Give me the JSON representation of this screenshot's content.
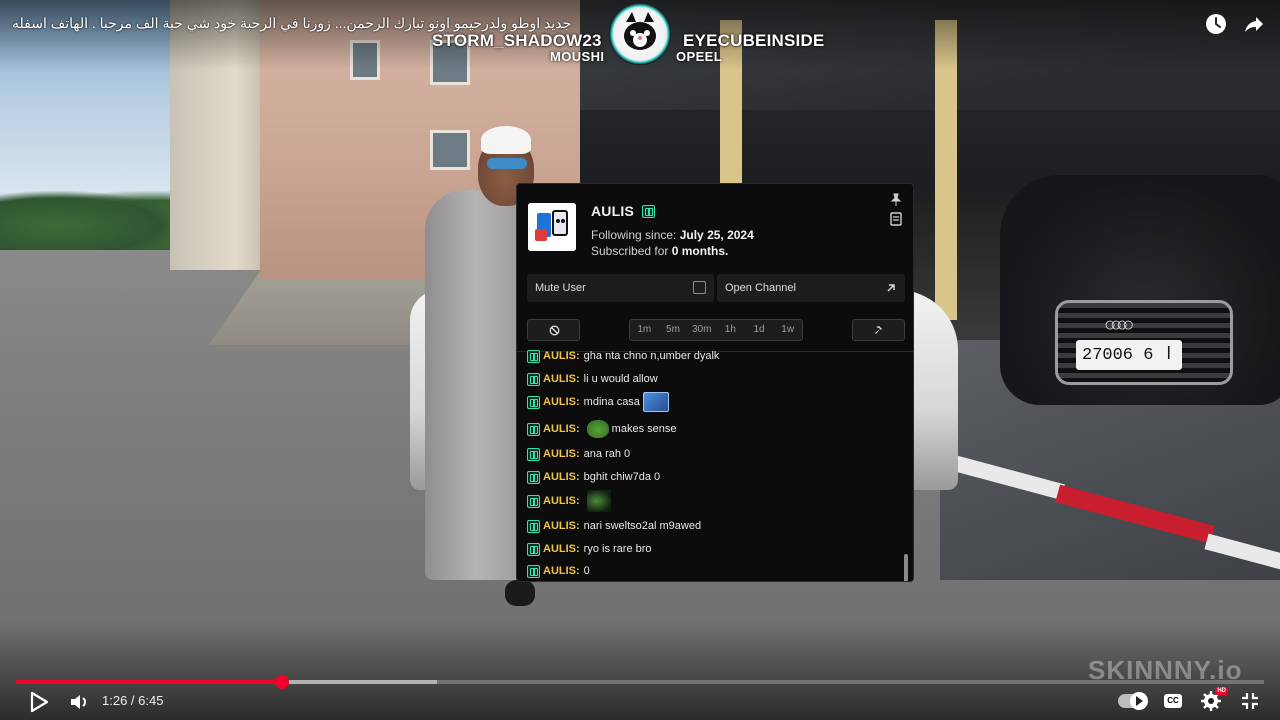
{
  "video": {
    "title": "جديد اوطو ولدرحيمو اونو تبارك الرحمن... زورنا في الرحبة خود شي حبة الف مرحبا . الهاتف اسفله",
    "plate_text": "27006 ا 6",
    "watermark": "SKINNNY.io"
  },
  "collab": {
    "left_name": "STORM_SHADOW23",
    "left_sub": "MOUSHI",
    "right_name": "EYECUBEINSIDE",
    "right_sub": "OPEEL"
  },
  "user_card": {
    "username": "AULIS",
    "following_label": "Following since:",
    "following_date": "July 25, 2024",
    "subscribed_label": "Subscribed for",
    "subscribed_value": "0 months.",
    "mute_label": "Mute User",
    "open_channel_label": "Open Channel",
    "timeouts": [
      "1m",
      "5m",
      "30m",
      "1h",
      "1d",
      "1w"
    ],
    "colors": {
      "badge": "#34e3a8",
      "username": "#f0c248"
    }
  },
  "chat": {
    "messages": [
      {
        "user": "AULIS:",
        "text": "gha nta chno n,umber dyalk",
        "emote": ""
      },
      {
        "user": "AULIS:",
        "text": "li u would allow",
        "emote": ""
      },
      {
        "user": "AULIS:",
        "text": "mdina casa",
        "emote": "card-emote"
      },
      {
        "user": "AULIS:",
        "text": "makes sense",
        "emote": "pepe-emote"
      },
      {
        "user": "AULIS:",
        "text": "ana rah 0",
        "emote": ""
      },
      {
        "user": "AULIS:",
        "text": "bghit chiw7da 0",
        "emote": ""
      },
      {
        "user": "AULIS:",
        "text": "",
        "emote": "pepe-dark-emote"
      },
      {
        "user": "AULIS:",
        "text": "nari sweltso2al m9awed",
        "emote": ""
      },
      {
        "user": "AULIS:",
        "text": "ryo is rare bro",
        "emote": ""
      },
      {
        "user": "AULIS:",
        "text": "0",
        "emote": ""
      }
    ]
  },
  "player": {
    "current_time": "1:26",
    "duration": "6:45",
    "time_label": "1:26 / 6:45",
    "progress_fraction": 0.213,
    "buffer_fraction": 0.337,
    "hd_label": "HD",
    "cc_label": "CC",
    "colors": {
      "accent": "#f0022a"
    }
  }
}
